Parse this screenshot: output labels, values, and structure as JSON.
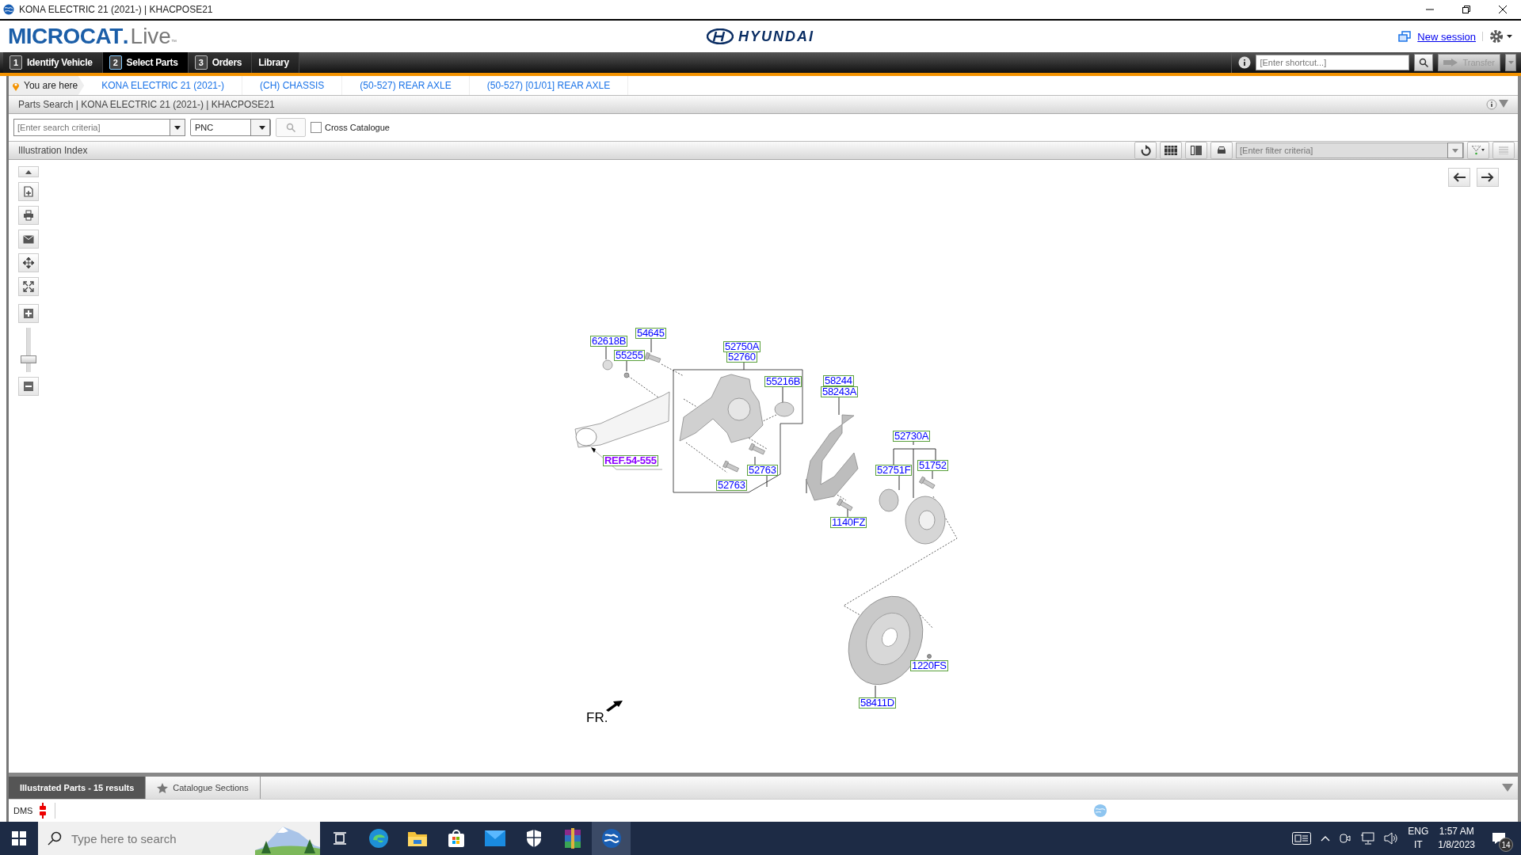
{
  "window": {
    "title": "KONA ELECTRIC 21 (2021-) | KHACPOSE21"
  },
  "header": {
    "logo_main": "MICROCAT",
    "logo_dot": ".",
    "logo_sub": "Live",
    "logo_tm": "™",
    "brand": "HYUNDAI",
    "new_session": "New session"
  },
  "nav": {
    "tabs": [
      {
        "number": "1",
        "label": "Identify Vehicle",
        "selected": false
      },
      {
        "number": "2",
        "label": "Select Parts",
        "selected": true
      },
      {
        "number": "3",
        "label": "Orders",
        "selected": false
      },
      {
        "label": "Library",
        "selected": false
      }
    ],
    "shortcut": {
      "placeholder": "[Enter shortcut...]"
    },
    "transfer": {
      "label": "Transfer",
      "disabled": true
    }
  },
  "breadcrumb": {
    "label": "You are here",
    "items": [
      "KONA ELECTRIC 21 (2021-)",
      "(CH) CHASSIS",
      "(50-527) REAR AXLE",
      "(50-527) [01/01] REAR AXLE"
    ]
  },
  "parts_search": {
    "title": "Parts Search | KONA ELECTRIC 21 (2021-) | KHACPOSE21",
    "search": {
      "placeholder": "[Enter search criteria]"
    },
    "mode": "PNC",
    "cross_catalogue": {
      "label": "Cross Catalogue",
      "checked": false
    }
  },
  "illustration": {
    "title": "Illustration Index",
    "filter": {
      "placeholder": "[Enter filter criteria]"
    },
    "zoom": {
      "level": 0.25
    },
    "callouts": [
      {
        "label": "62618B",
        "kind": "part"
      },
      {
        "label": "54645",
        "kind": "part"
      },
      {
        "label": "55255",
        "kind": "part"
      },
      {
        "label": "52750A",
        "kind": "part"
      },
      {
        "label": "52760",
        "kind": "part"
      },
      {
        "label": "55216B",
        "kind": "part"
      },
      {
        "label": "58244",
        "kind": "part"
      },
      {
        "label": "58243A",
        "kind": "part"
      },
      {
        "label": "REF.54-555",
        "kind": "reference"
      },
      {
        "label": "52763",
        "kind": "part"
      },
      {
        "label": "52763",
        "kind": "part"
      },
      {
        "label": "1140FZ",
        "kind": "part"
      },
      {
        "label": "52730A",
        "kind": "part"
      },
      {
        "label": "52751F",
        "kind": "part"
      },
      {
        "label": "51752",
        "kind": "part"
      },
      {
        "label": "1220FS",
        "kind": "part"
      },
      {
        "label": "58411D",
        "kind": "part"
      }
    ],
    "direction_label": "FR."
  },
  "bottom_tabs": [
    {
      "label": "Illustrated Parts - 15 results",
      "selected": true
    },
    {
      "label": "Catalogue Sections",
      "selected": false
    }
  ],
  "status_bar": {
    "label": "DMS"
  },
  "taskbar": {
    "search": {
      "placeholder": "Type here to search"
    },
    "apps": [
      {
        "kind": "taskview",
        "active": false
      },
      {
        "kind": "edge",
        "active": false
      },
      {
        "kind": "explorer",
        "active": false
      },
      {
        "kind": "store",
        "active": false
      },
      {
        "kind": "mail",
        "active": false
      },
      {
        "kind": "security",
        "active": false
      },
      {
        "kind": "archiver",
        "active": false
      },
      {
        "kind": "globe",
        "active": true
      }
    ],
    "language": "ENG",
    "region": "IT",
    "time": "1:57 AM",
    "date": "1/8/2023",
    "notifications": "14"
  }
}
